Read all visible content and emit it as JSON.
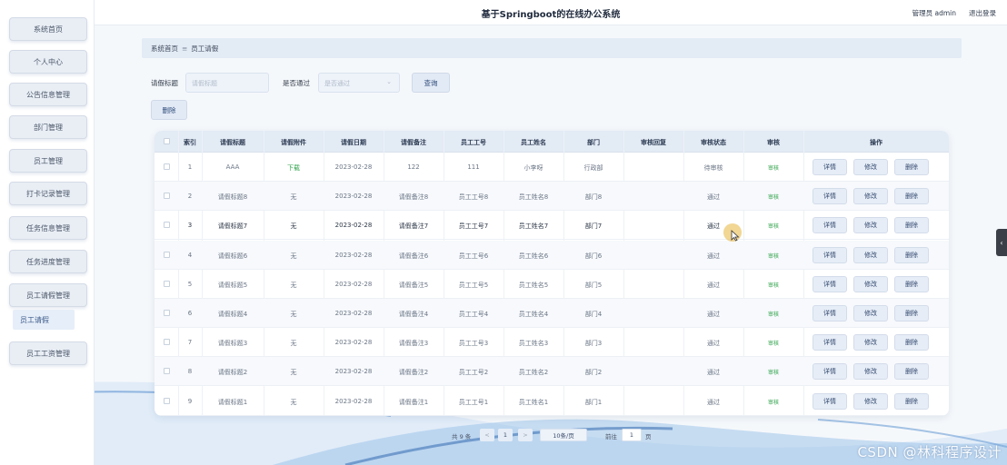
{
  "header": {
    "site_title": "基于Springboot的在线办公系统",
    "admin_label": "管理员 admin",
    "logout_label": "退出登录"
  },
  "sidebar": {
    "items": [
      {
        "label": "系统首页"
      },
      {
        "label": "个人中心"
      },
      {
        "label": "公告信息管理"
      },
      {
        "label": "部门管理"
      },
      {
        "label": "员工管理"
      },
      {
        "label": "打卡记录管理"
      },
      {
        "label": "任务信息管理"
      },
      {
        "label": "任务进度管理"
      },
      {
        "label": "员工请假管理"
      },
      {
        "label": "员工工资管理"
      }
    ],
    "active_sub": "员工请假"
  },
  "breadcrumb": {
    "home": "系统首页",
    "separator": "≡",
    "current": "员工请假"
  },
  "search": {
    "title_label": "请假标题",
    "title_placeholder": "请假标题",
    "pass_label": "是否通过",
    "pass_placeholder": "是否通过",
    "query_button": "查询",
    "delete_button": "删除"
  },
  "table": {
    "columns": [
      "索引",
      "请假标题",
      "请假附件",
      "请假日期",
      "请假备注",
      "员工工号",
      "员工姓名",
      "部门",
      "审核回复",
      "审核状态",
      "审核",
      "操作"
    ],
    "rows": [
      {
        "index": "1",
        "title": "AAA",
        "attachment": "下载",
        "date": "2023-02-28",
        "remark": "122",
        "emp_no": "111",
        "emp_name": "小李呀",
        "dept": "行政部",
        "reply": "",
        "status": "待审核",
        "audit": "审核"
      },
      {
        "index": "2",
        "title": "请假标题8",
        "attachment": "无",
        "date": "2023-02-28",
        "remark": "请假备注8",
        "emp_no": "员工工号8",
        "emp_name": "员工姓名8",
        "dept": "部门8",
        "reply": "",
        "status": "通过",
        "audit": "审核"
      },
      {
        "index": "3",
        "title": "请假标题7",
        "attachment": "无",
        "date": "2023-02-28",
        "remark": "请假备注7",
        "emp_no": "员工工号7",
        "emp_name": "员工姓名7",
        "dept": "部门7",
        "reply": "",
        "status": "通过",
        "audit": "审核"
      },
      {
        "index": "4",
        "title": "请假标题6",
        "attachment": "无",
        "date": "2023-02-28",
        "remark": "请假备注6",
        "emp_no": "员工工号6",
        "emp_name": "员工姓名6",
        "dept": "部门6",
        "reply": "",
        "status": "通过",
        "audit": "审核"
      },
      {
        "index": "5",
        "title": "请假标题5",
        "attachment": "无",
        "date": "2023-02-28",
        "remark": "请假备注5",
        "emp_no": "员工工号5",
        "emp_name": "员工姓名5",
        "dept": "部门5",
        "reply": "",
        "status": "通过",
        "audit": "审核"
      },
      {
        "index": "6",
        "title": "请假标题4",
        "attachment": "无",
        "date": "2023-02-28",
        "remark": "请假备注4",
        "emp_no": "员工工号4",
        "emp_name": "员工姓名4",
        "dept": "部门4",
        "reply": "",
        "status": "通过",
        "audit": "审核"
      },
      {
        "index": "7",
        "title": "请假标题3",
        "attachment": "无",
        "date": "2023-02-28",
        "remark": "请假备注3",
        "emp_no": "员工工号3",
        "emp_name": "员工姓名3",
        "dept": "部门3",
        "reply": "",
        "status": "通过",
        "audit": "审核"
      },
      {
        "index": "8",
        "title": "请假标题2",
        "attachment": "无",
        "date": "2023-02-28",
        "remark": "请假备注2",
        "emp_no": "员工工号2",
        "emp_name": "员工姓名2",
        "dept": "部门2",
        "reply": "",
        "status": "通过",
        "audit": "审核"
      },
      {
        "index": "9",
        "title": "请假标题1",
        "attachment": "无",
        "date": "2023-02-28",
        "remark": "请假备注1",
        "emp_no": "员工工号1",
        "emp_name": "员工姓名1",
        "dept": "部门1",
        "reply": "",
        "status": "通过",
        "audit": "审核"
      }
    ],
    "row_actions": {
      "detail": "详情",
      "edit": "修改",
      "delete": "删除"
    }
  },
  "pagination": {
    "total": "共 9 条",
    "prev": "<",
    "current_page": "1",
    "next": ">",
    "page_size": "10条/页",
    "goto_label": "前往",
    "goto_value": "1",
    "page_unit": "页"
  },
  "watermark": "CSDN @林科程序设计",
  "colors": {
    "accent": "#e3ebf5",
    "success": "#2fa24a",
    "primary_text": "#1f2a3d"
  }
}
